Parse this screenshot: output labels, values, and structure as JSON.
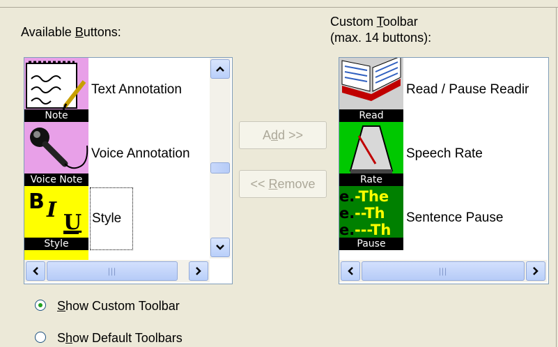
{
  "available": {
    "label_pre": "Available ",
    "label_u": "B",
    "label_post": "uttons:",
    "items": [
      {
        "label": "Text Annotation",
        "caption": "Note",
        "icon": "note-icon"
      },
      {
        "label": "Voice Annotation",
        "caption": "Voice Note",
        "icon": "microphone-icon"
      },
      {
        "label": "Style",
        "caption": "Style",
        "icon": "bold-italic-underline-icon"
      }
    ]
  },
  "custom": {
    "label_line1_pre": "Custom ",
    "label_line1_u": "T",
    "label_line1_post": "oolbar",
    "label_line2": "(max. 14 buttons):",
    "items": [
      {
        "label": "Read / Pause Readir",
        "caption": "Read",
        "icon": "book-icon"
      },
      {
        "label": "Speech Rate",
        "caption": "Rate",
        "icon": "metronome-icon"
      },
      {
        "label": "Sentence Pause",
        "caption": "Pause",
        "icon": "sentence-pause-icon"
      }
    ]
  },
  "buttons": {
    "add_pre": "A",
    "add_u": "d",
    "add_post": "d >>",
    "remove_pre": "<< ",
    "remove_u": "R",
    "remove_post": "emove"
  },
  "options": {
    "show_custom_u": "S",
    "show_custom_post": "how Custom Toolbar",
    "show_default_pre": "S",
    "show_default_u": "h",
    "show_default_post": "ow Default Toolbars",
    "selected": "show_custom"
  },
  "colors": {
    "accent": "#7f9db9",
    "scroll": "#b9cffa",
    "note_bg": "#f0a8f0",
    "style_bg": "#ffff00",
    "green_bg": "#00c800"
  }
}
